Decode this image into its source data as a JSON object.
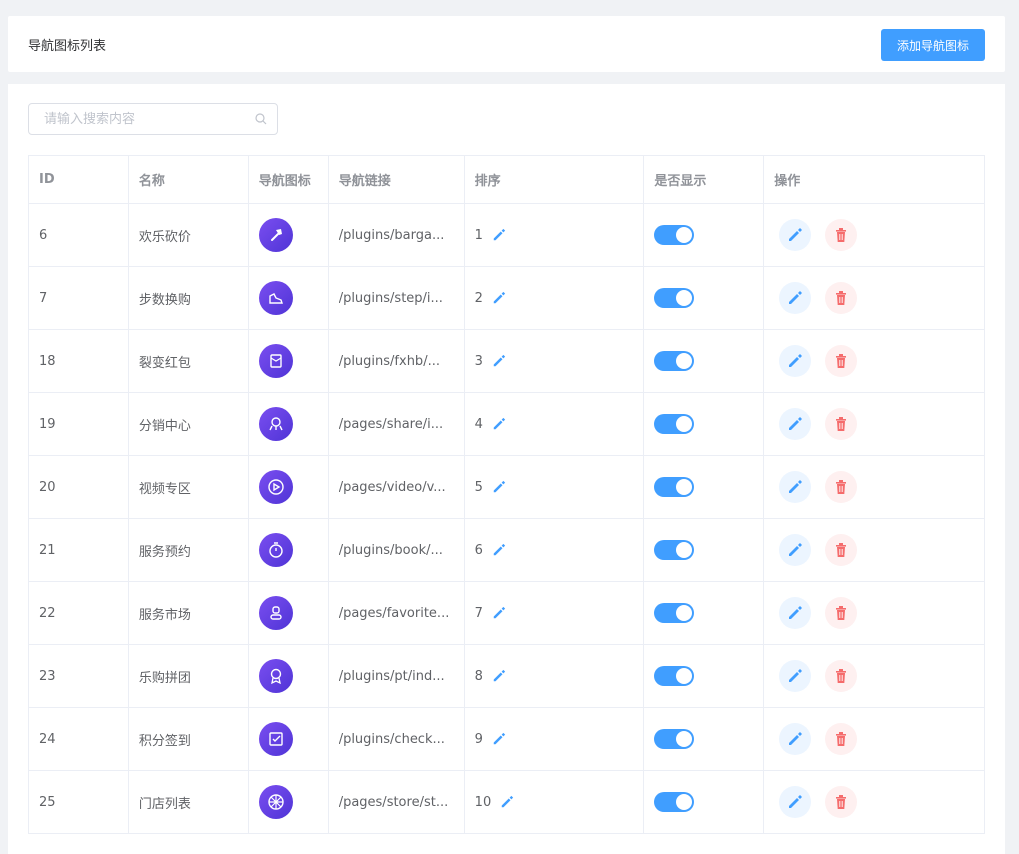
{
  "header": {
    "title": "导航图标列表",
    "add_button": "添加导航图标"
  },
  "search": {
    "placeholder": "请输入搜索内容",
    "value": ""
  },
  "table": {
    "columns": [
      "ID",
      "名称",
      "导航图标",
      "导航链接",
      "排序",
      "是否显示",
      "操作"
    ],
    "rows": [
      {
        "id": "6",
        "name": "欢乐砍价",
        "icon": "axe-icon",
        "link": "/plugins/barga...",
        "sort": "1",
        "show": true
      },
      {
        "id": "7",
        "name": "步数换购",
        "icon": "sneaker-icon",
        "link": "/plugins/step/i...",
        "sort": "2",
        "show": true
      },
      {
        "id": "18",
        "name": "裂变红包",
        "icon": "red-envelope-icon",
        "link": "/plugins/fxhb/...",
        "sort": "3",
        "show": true
      },
      {
        "id": "19",
        "name": "分销中心",
        "icon": "share-network-icon",
        "link": "/pages/share/i...",
        "sort": "4",
        "show": true
      },
      {
        "id": "20",
        "name": "视频专区",
        "icon": "play-icon",
        "link": "/pages/video/v...",
        "sort": "5",
        "show": true
      },
      {
        "id": "21",
        "name": "服务预约",
        "icon": "stopwatch-icon",
        "link": "/plugins/book/...",
        "sort": "6",
        "show": true
      },
      {
        "id": "22",
        "name": "服务市场",
        "icon": "user-badge-icon",
        "link": "/pages/favorite...",
        "sort": "7",
        "show": true
      },
      {
        "id": "23",
        "name": "乐购拼团",
        "icon": "award-ribbon-icon",
        "link": "/plugins/pt/ind...",
        "sort": "8",
        "show": true
      },
      {
        "id": "24",
        "name": "积分签到",
        "icon": "checkbox-icon",
        "link": "/plugins/check...",
        "sort": "9",
        "show": true
      },
      {
        "id": "25",
        "name": "门店列表",
        "icon": "wheel-icon",
        "link": "/pages/store/st...",
        "sort": "10",
        "show": true
      }
    ]
  },
  "colors": {
    "primary": "#409eff",
    "danger": "#f56c6c",
    "icon_gradient_start": "#7a4ef0",
    "icon_gradient_end": "#4f34d6"
  }
}
